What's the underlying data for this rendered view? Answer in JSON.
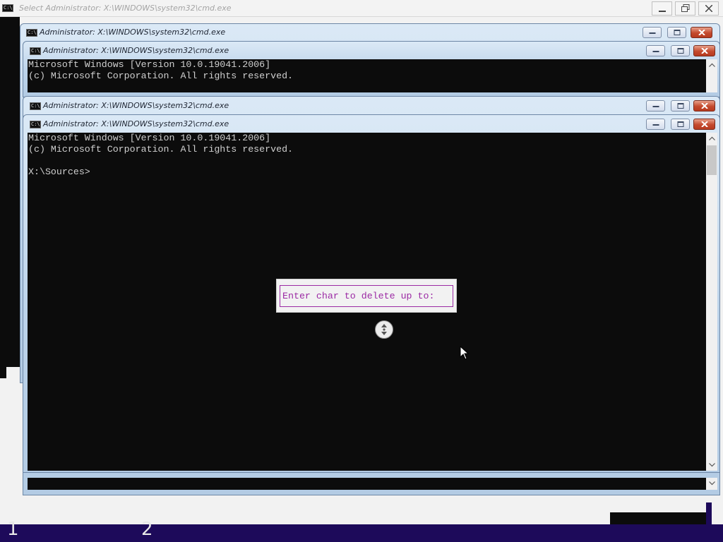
{
  "outer_window": {
    "title": "Select Administrator: X:\\WINDOWS\\system32\\cmd.exe"
  },
  "cmd_windows": [
    {
      "title": "Administrator: X:\\WINDOWS\\system32\\cmd.exe"
    },
    {
      "title": "Administrator: X:\\WINDOWS\\system32\\cmd.exe",
      "lines": [
        "Microsoft Windows [Version 10.0.19041.2006]",
        "(c) Microsoft Corporation. All rights reserved."
      ]
    },
    {
      "title": "Administrator: X:\\WINDOWS\\system32\\cmd.exe"
    },
    {
      "title": "Administrator: X:\\WINDOWS\\system32\\cmd.exe",
      "lines": [
        "Microsoft Windows [Version 10.0.19041.2006]",
        "(c) Microsoft Corporation. All rights reserved.",
        "",
        "X:\\Sources>"
      ]
    }
  ],
  "prompt_dialog": {
    "text": "Enter char to delete up to:"
  },
  "taskbar": {
    "labels": [
      "1",
      "2"
    ]
  },
  "colors": {
    "console_bg": "#0c0c0c",
    "console_text": "#cfcfcf",
    "dialog_text": "#9b2aa4",
    "taskbar": "#1d0a5a"
  },
  "icons": [
    "cmd-app-icon",
    "minimize-icon",
    "maximize-icon",
    "restore-icon",
    "close-icon",
    "scroll-up-icon",
    "scroll-down-icon",
    "move-cursor-icon",
    "mouse-pointer-icon"
  ]
}
